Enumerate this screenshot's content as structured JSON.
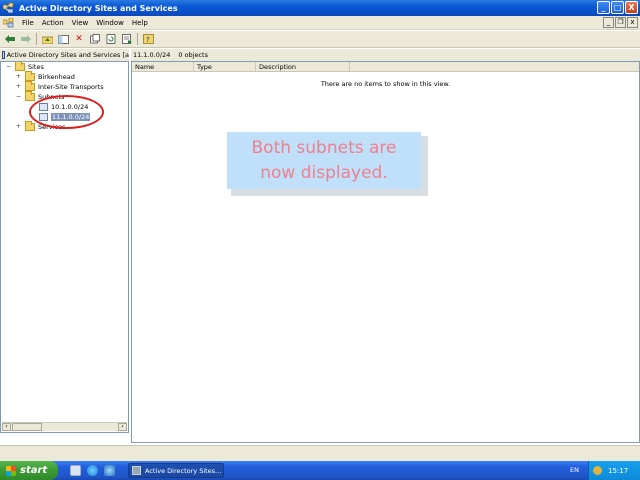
{
  "window": {
    "title": "Active Directory Sites and Services",
    "buttons": {
      "minimize": "_",
      "maximize": "□",
      "close": "X"
    }
  },
  "menu": {
    "items": [
      {
        "label": "File"
      },
      {
        "label": "Action"
      },
      {
        "label": "View"
      },
      {
        "label": "Window"
      },
      {
        "label": "Help"
      }
    ]
  },
  "toolbar": {
    "icons": [
      "back-icon",
      "forward-icon",
      "up-folder-icon",
      "show-hide-tree-icon",
      "delete-icon",
      "properties-icon",
      "refresh-icon",
      "export-list-icon",
      "help-icon"
    ]
  },
  "left_pane": {
    "header": "Active Directory Sites and Services [a",
    "tree": [
      {
        "label": "Sites",
        "expander": "−",
        "icon": "folder-icon"
      },
      {
        "label": "Birkenhead",
        "expander": "+",
        "icon": "folder-icon"
      },
      {
        "label": "Inter-Site Transports",
        "expander": "+",
        "icon": "folder-icon"
      },
      {
        "label": "Subnets",
        "expander": "−",
        "icon": "folder-icon"
      },
      {
        "label": "10.1.0.0/24",
        "expander": "",
        "icon": "subnet-icon"
      },
      {
        "label": "11.1.0.0/24",
        "expander": "",
        "icon": "subnet-icon",
        "selected": true
      },
      {
        "label": "Services",
        "expander": "+",
        "icon": "folder-icon"
      }
    ]
  },
  "right_pane": {
    "header_path": "11.1.0.0/24",
    "header_count": "0 objects",
    "columns": [
      "Name",
      "Type",
      "Description"
    ],
    "empty_message": "There are no items to show in this view."
  },
  "callout": {
    "line1": "Both subnets are",
    "line2": "now displayed."
  },
  "taskbar": {
    "start_label": "start",
    "task_button": "Active Directory Sites...",
    "language": "EN",
    "clock": "15:17"
  },
  "colors": {
    "titlebar": "#0a58d6",
    "callout_bg": "#bfe0f8",
    "callout_text": "#ef7f8e",
    "annotation_circle": "#e21a1a",
    "selection": "#7c91b9"
  }
}
